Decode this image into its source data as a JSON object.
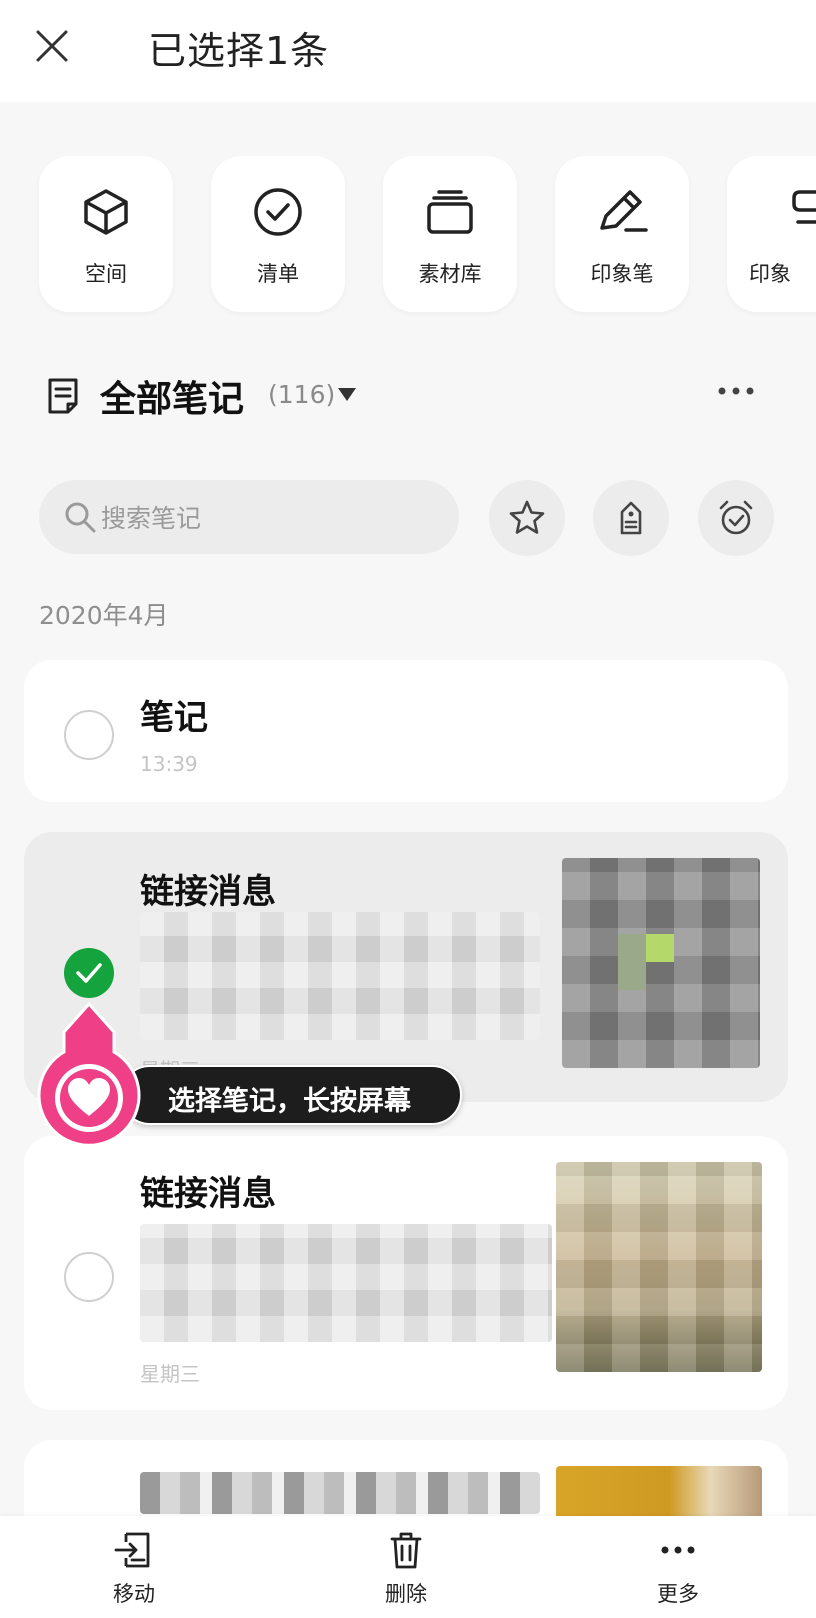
{
  "header": {
    "title": "已选择1条",
    "close_icon": "close-icon"
  },
  "shortcuts": [
    {
      "label": "空间",
      "icon": "cube-icon"
    },
    {
      "label": "清单",
      "icon": "check-circle-icon"
    },
    {
      "label": "素材库",
      "icon": "stack-icon"
    },
    {
      "label": "印象笔",
      "icon": "pen-icon"
    },
    {
      "label": "印象",
      "icon": "partial-icon"
    }
  ],
  "section": {
    "title": "全部笔记",
    "count": "(116)",
    "more_icon": "more-dots-icon"
  },
  "search": {
    "placeholder": "搜索笔记"
  },
  "filters": [
    {
      "icon": "star-icon"
    },
    {
      "icon": "tag-icon"
    },
    {
      "icon": "alarm-icon"
    }
  ],
  "date_group": "2020年4月",
  "notes": [
    {
      "title": "笔记",
      "time": "13:39",
      "selected": false
    },
    {
      "title": "链接消息",
      "time": "星期三",
      "selected": true
    },
    {
      "title": "链接消息",
      "time": "星期三",
      "selected": false
    }
  ],
  "tooltip": {
    "text": "选择笔记，长按屏幕",
    "icon": "heart-icon"
  },
  "bottom_bar": {
    "move": "移动",
    "delete": "删除",
    "more": "更多"
  },
  "colors": {
    "accent_green": "#14a33c",
    "pin_pink": "#ef3f86",
    "tooltip_bg": "#1d1d1d"
  }
}
